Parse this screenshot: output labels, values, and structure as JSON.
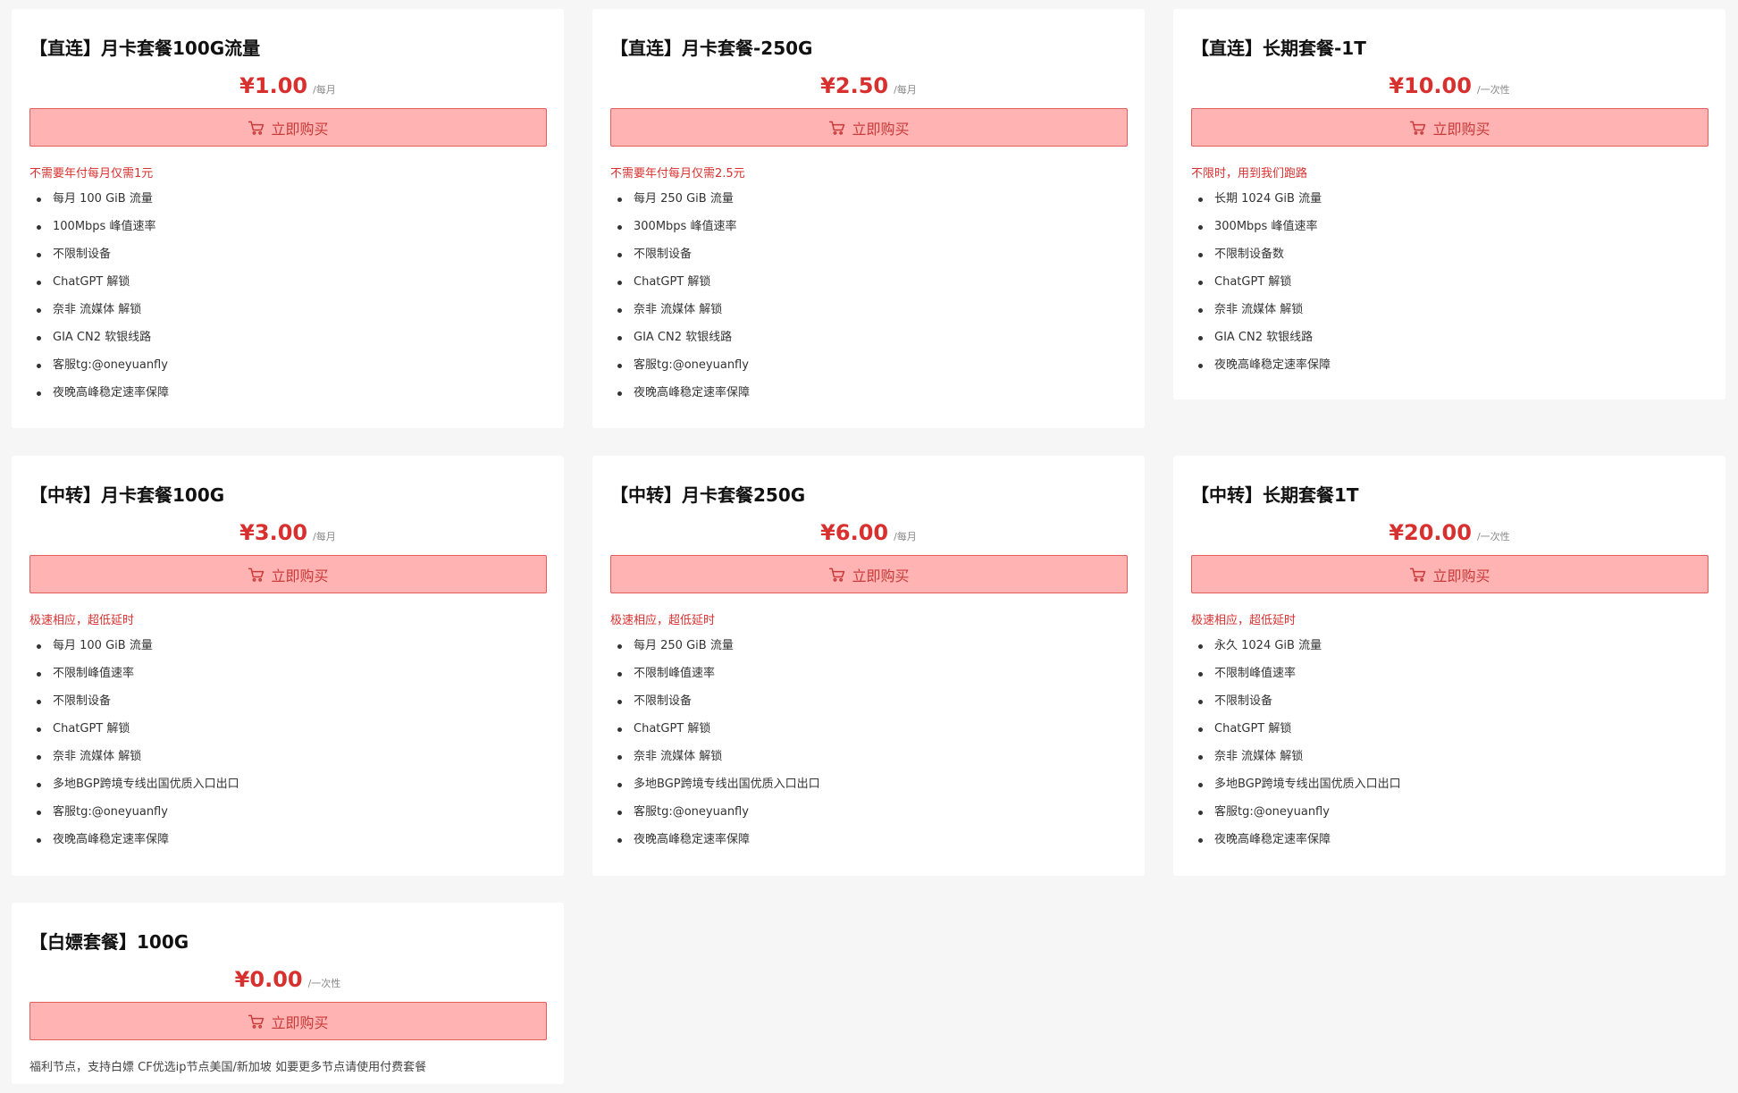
{
  "buy_label": "立即购买",
  "accent_color": "#d8302f",
  "button_color": "#ffb3b3",
  "plans": [
    {
      "title": "【直连】月卡套餐100G流量",
      "price": "¥1.00",
      "period": "/每月",
      "note": "不需要年付每月仅需1元",
      "features": [
        "每月 100 GiB 流量",
        "100Mbps 峰值速率",
        "不限制设备",
        "ChatGPT 解锁",
        "奈非 流媒体 解锁",
        "GIA CN2 软银线路",
        "客服tg:@oneyuanfly",
        "夜晚高峰稳定速率保障"
      ]
    },
    {
      "title": "【直连】月卡套餐-250G",
      "price": "¥2.50",
      "period": "/每月",
      "note": "不需要年付每月仅需2.5元",
      "features": [
        "每月 250 GiB 流量",
        "300Mbps 峰值速率",
        "不限制设备",
        "ChatGPT 解锁",
        "奈非 流媒体 解锁",
        "GIA CN2 软银线路",
        "客服tg:@oneyuanfly",
        "夜晚高峰稳定速率保障"
      ]
    },
    {
      "title": "【直连】长期套餐-1T",
      "price": "¥10.00",
      "period": "/一次性",
      "note": "不限时，用到我们跑路",
      "features": [
        "长期 1024 GiB 流量",
        "300Mbps 峰值速率",
        "不限制设备数",
        "ChatGPT 解锁",
        "奈非 流媒体 解锁",
        "GIA CN2 软银线路",
        "夜晚高峰稳定速率保障"
      ]
    },
    {
      "title": "【中转】月卡套餐100G",
      "price": "¥3.00",
      "period": "/每月",
      "note": "极速相应，超低延时",
      "features": [
        "每月 100 GiB 流量",
        "不限制峰值速率",
        "不限制设备",
        "ChatGPT 解锁",
        "奈非 流媒体 解锁",
        "多地BGP跨境专线出国优质入口出口",
        "客服tg:@oneyuanfly",
        "夜晚高峰稳定速率保障"
      ]
    },
    {
      "title": "【中转】月卡套餐250G",
      "price": "¥6.00",
      "period": "/每月",
      "note": "极速相应，超低延时",
      "features": [
        "每月 250 GiB 流量",
        "不限制峰值速率",
        "不限制设备",
        "ChatGPT 解锁",
        "奈非 流媒体 解锁",
        "多地BGP跨境专线出国优质入口出口",
        "客服tg:@oneyuanfly",
        "夜晚高峰稳定速率保障"
      ]
    },
    {
      "title": "【中转】长期套餐1T",
      "price": "¥20.00",
      "period": "/一次性",
      "note": "极速相应，超低延时",
      "features": [
        "永久 1024 GiB 流量",
        "不限制峰值速率",
        "不限制设备",
        "ChatGPT 解锁",
        "奈非 流媒体 解锁",
        "多地BGP跨境专线出国优质入口出口",
        "客服tg:@oneyuanfly",
        "夜晚高峰稳定速率保障"
      ]
    },
    {
      "title": "【白嫖套餐】100G",
      "price": "¥0.00",
      "period": "/一次性",
      "note": "福利节点，支持白嫖 CF优选ip节点美国/新加坡 如要更多节点请使用付费套餐",
      "note_style": "plain",
      "features": []
    }
  ]
}
